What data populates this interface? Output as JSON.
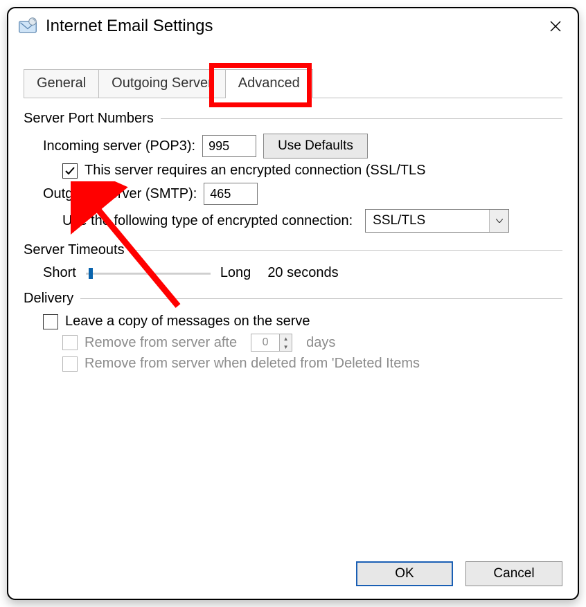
{
  "window": {
    "title": "Internet Email Settings"
  },
  "tabs": {
    "general": "General",
    "outgoing": "Outgoing Server",
    "advanced": "Advanced"
  },
  "groups": {
    "ports": "Server Port Numbers",
    "timeouts": "Server Timeouts",
    "delivery": "Delivery"
  },
  "ports": {
    "incoming_label": "Incoming server (POP3):",
    "incoming_value": "995",
    "use_defaults": "Use Defaults",
    "ssl_checkbox_label": "This server requires an encrypted connection (SSL/TLS",
    "ssl_checked": true,
    "outgoing_label": "Outgoing server (SMTP):",
    "outgoing_value": "465",
    "enc_type_label": "Use the following type of encrypted connection:",
    "enc_type_value": "SSL/TLS"
  },
  "timeouts": {
    "short": "Short",
    "long": "Long",
    "value_text": "20 seconds"
  },
  "delivery": {
    "leave_copy": "Leave a copy of messages on the serve",
    "remove_after": "Remove from server afte",
    "days_value": "0",
    "days_label": "days",
    "remove_deleted": "Remove from server when deleted from 'Deleted Items"
  },
  "buttons": {
    "ok": "OK",
    "cancel": "Cancel"
  }
}
